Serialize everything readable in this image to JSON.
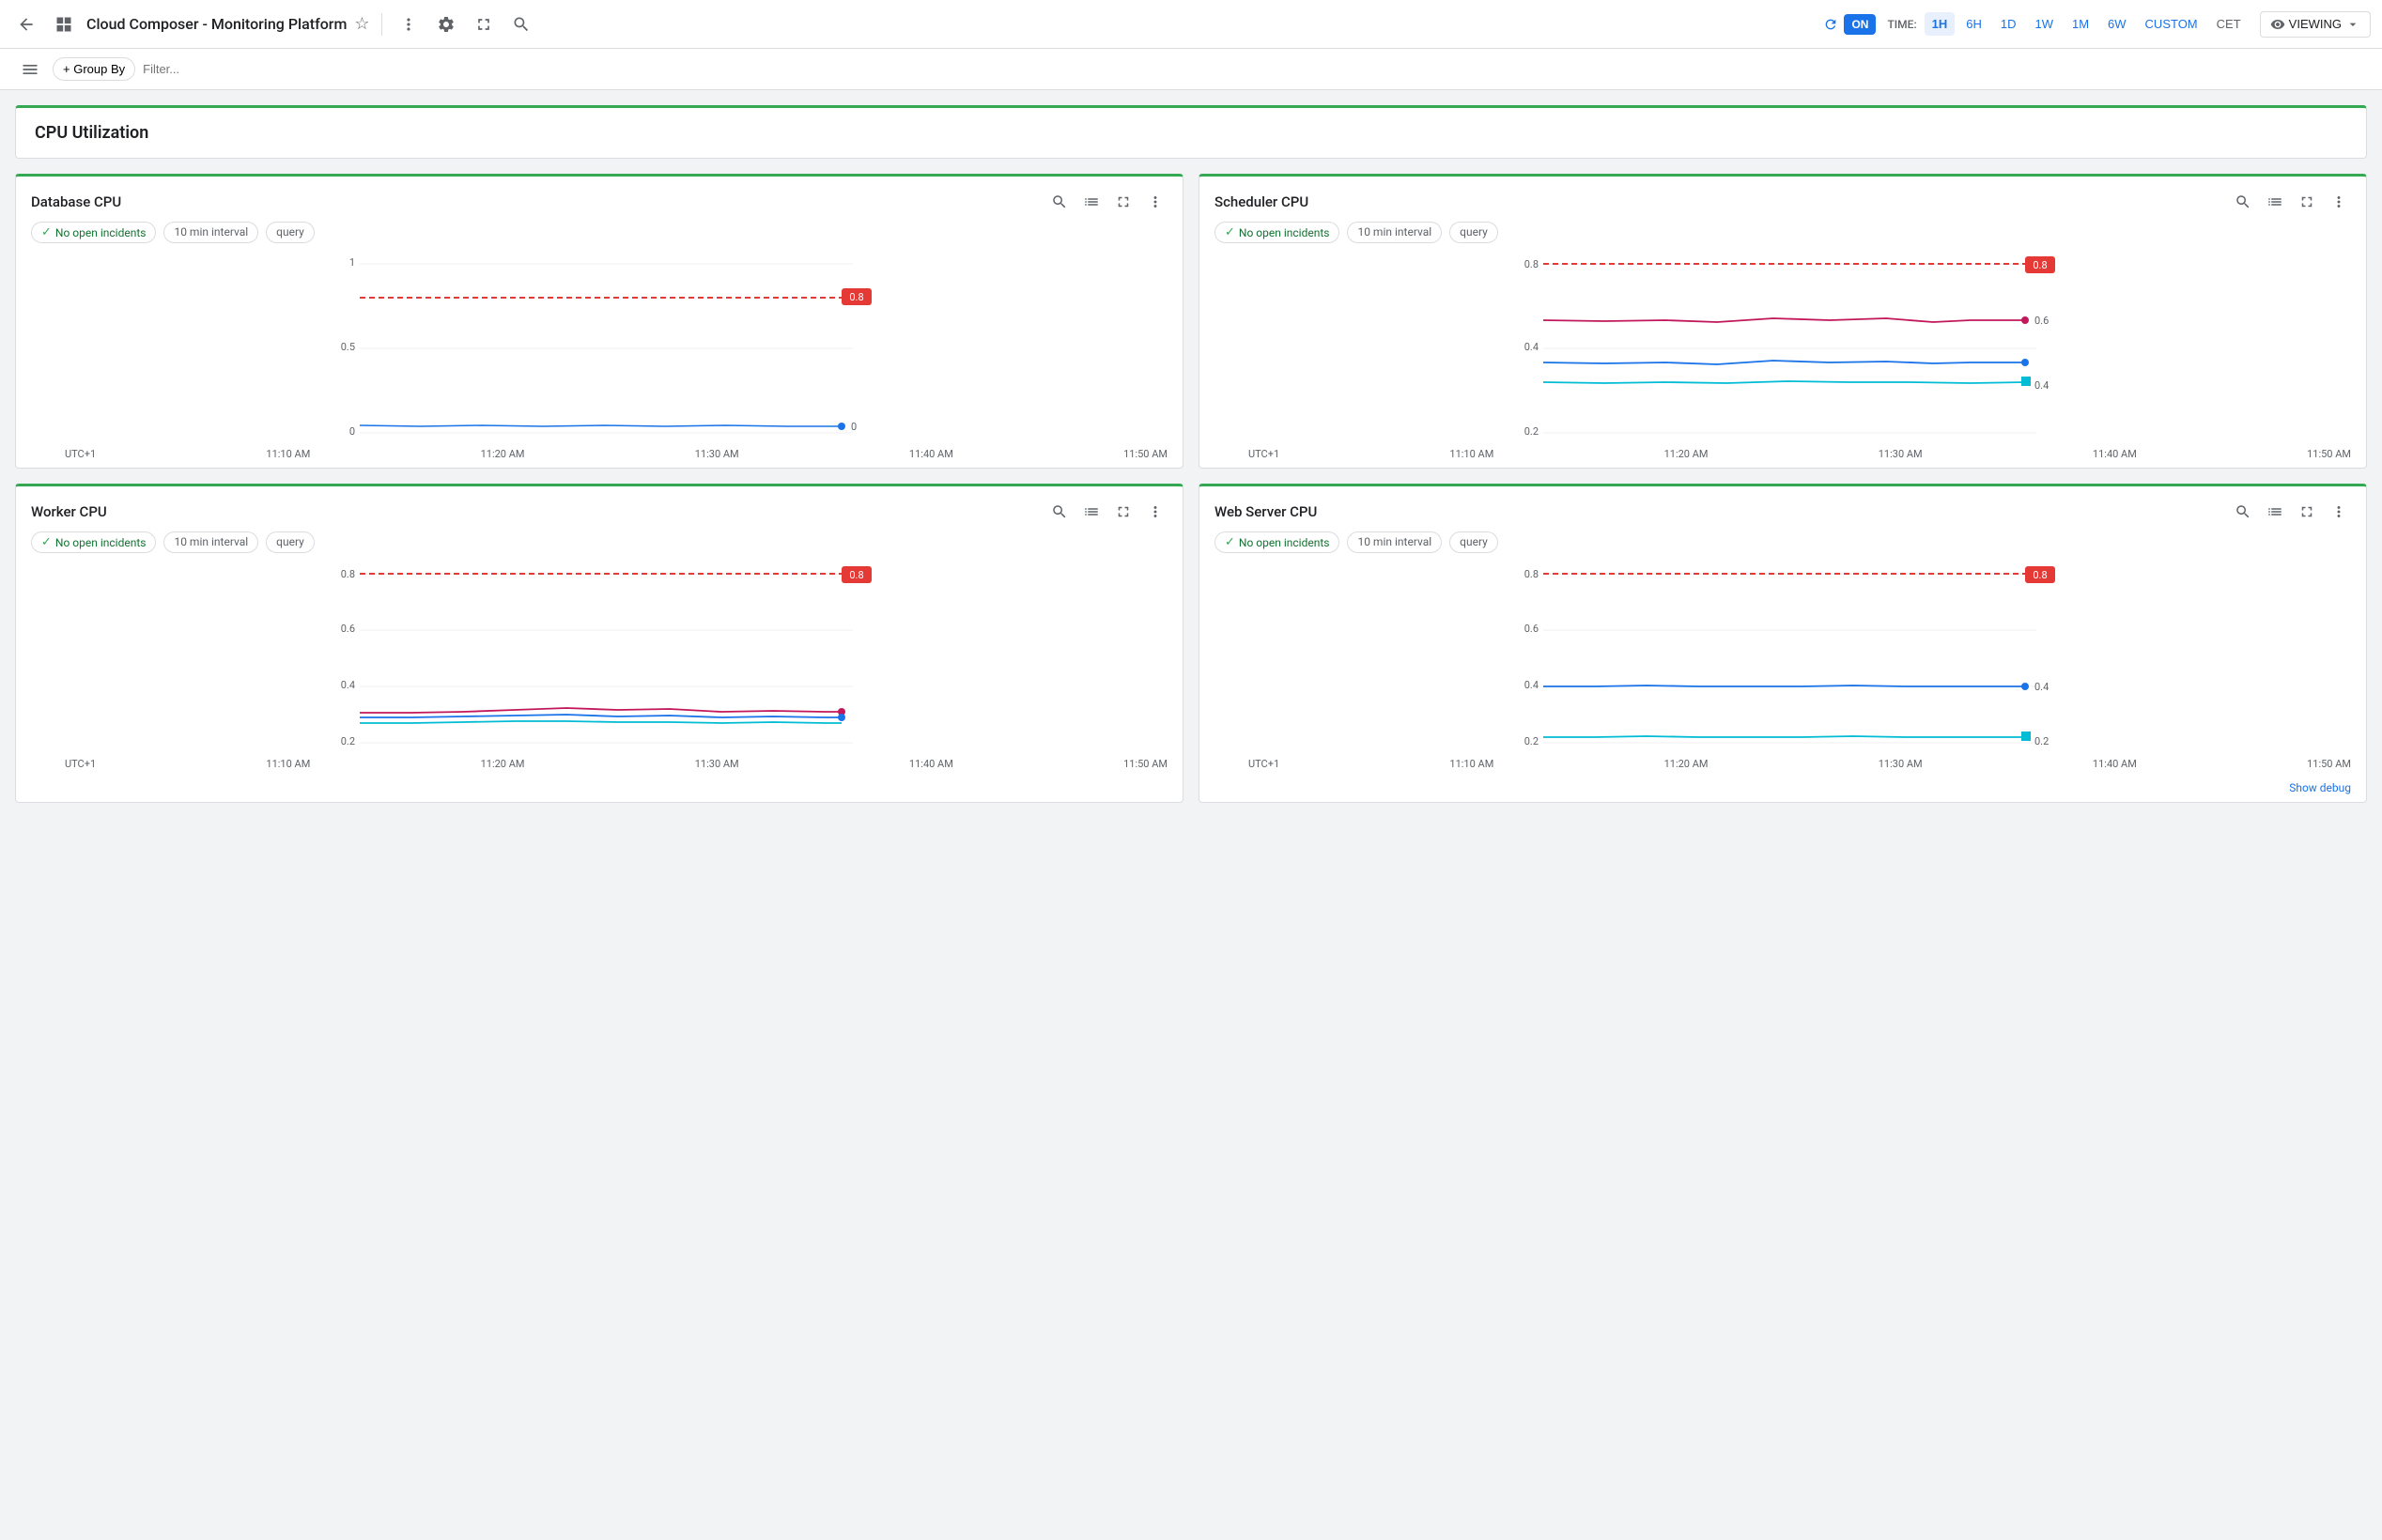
{
  "toolbar": {
    "back_icon": "←",
    "grid_icon": "⊞",
    "title": "Cloud Composer - Monitoring Platform",
    "star_icon": "☆",
    "more_icon": "⋮",
    "settings_icon": "⚙",
    "expand_icon": "⛶",
    "search_icon": "🔍",
    "refresh_label": "ON",
    "time_label": "TIME:",
    "time_options": [
      "1H",
      "6H",
      "1D",
      "1W",
      "1M",
      "6W",
      "CUSTOM",
      "CET"
    ],
    "active_time": "1H",
    "viewing_label": "VIEWING",
    "viewing_icon": "👁"
  },
  "filter_bar": {
    "group_by_label": "+ Group By",
    "filter_placeholder": "Filter..."
  },
  "section": {
    "title": "CPU Utilization"
  },
  "charts": [
    {
      "id": "database-cpu",
      "title": "Database CPU",
      "incidents_label": "No open incidents",
      "interval_label": "10 min interval",
      "query_label": "query",
      "y_max": "1",
      "y_mid": "0.5",
      "y_low": "0",
      "threshold_label": "0.8",
      "x_labels": [
        "UTC+1",
        "11:10 AM",
        "11:20 AM",
        "11:30 AM",
        "11:40 AM",
        "11:50 AM"
      ],
      "lines": [
        {
          "color": "#e53935",
          "dashed": true,
          "y_pos": 0.8
        },
        {
          "color": "#1a73e8",
          "dashed": false,
          "y_pos": 0.04
        }
      ]
    },
    {
      "id": "scheduler-cpu",
      "title": "Scheduler CPU",
      "incidents_label": "No open incidents",
      "interval_label": "10 min interval",
      "query_label": "query",
      "y_max": "0.8",
      "y_mid": "",
      "y_low": "0.2",
      "threshold_label": "0.8",
      "x_labels": [
        "UTC+1",
        "11:10 AM",
        "11:20 AM",
        "11:30 AM",
        "11:40 AM",
        "11:50 AM"
      ],
      "lines": [
        {
          "color": "#e53935",
          "dashed": true,
          "y_pos": 0.8
        },
        {
          "color": "#c2185b",
          "dashed": false,
          "y_pos": 0.6
        },
        {
          "color": "#1a73e8",
          "dashed": false,
          "y_pos": 0.45
        },
        {
          "color": "#00bcd4",
          "dashed": false,
          "y_pos": 0.38
        }
      ]
    },
    {
      "id": "worker-cpu",
      "title": "Worker CPU",
      "incidents_label": "No open incidents",
      "interval_label": "10 min interval",
      "query_label": "query",
      "y_max": "0.8",
      "y_mid": "0.6",
      "y_low": "0.2",
      "threshold_label": "0.8",
      "x_labels": [
        "UTC+1",
        "11:10 AM",
        "11:20 AM",
        "11:30 AM",
        "11:40 AM",
        "11:50 AM"
      ],
      "lines": [
        {
          "color": "#e53935",
          "dashed": true,
          "y_pos": 0.8
        },
        {
          "color": "#c2185b",
          "dashed": false,
          "y_pos": 0.3
        },
        {
          "color": "#1a73e8",
          "dashed": false,
          "y_pos": 0.28
        },
        {
          "color": "#00bcd4",
          "dashed": false,
          "y_pos": 0.27
        }
      ]
    },
    {
      "id": "webserver-cpu",
      "title": "Web Server CPU",
      "incidents_label": "No open incidents",
      "interval_label": "10 min interval",
      "query_label": "query",
      "y_max": "0.8",
      "y_mid": "0.6",
      "y_low": "0.2",
      "threshold_label": "0.8",
      "x_labels": [
        "UTC+1",
        "11:10 AM",
        "11:20 AM",
        "11:30 AM",
        "11:40 AM",
        "11:50 AM"
      ],
      "lines": [
        {
          "color": "#e53935",
          "dashed": true,
          "y_pos": 0.8
        },
        {
          "color": "#1a73e8",
          "dashed": false,
          "y_pos": 0.4
        },
        {
          "color": "#00bcd4",
          "dashed": false,
          "y_pos": 0.22
        }
      ]
    }
  ],
  "show_debug_label": "Show debug"
}
